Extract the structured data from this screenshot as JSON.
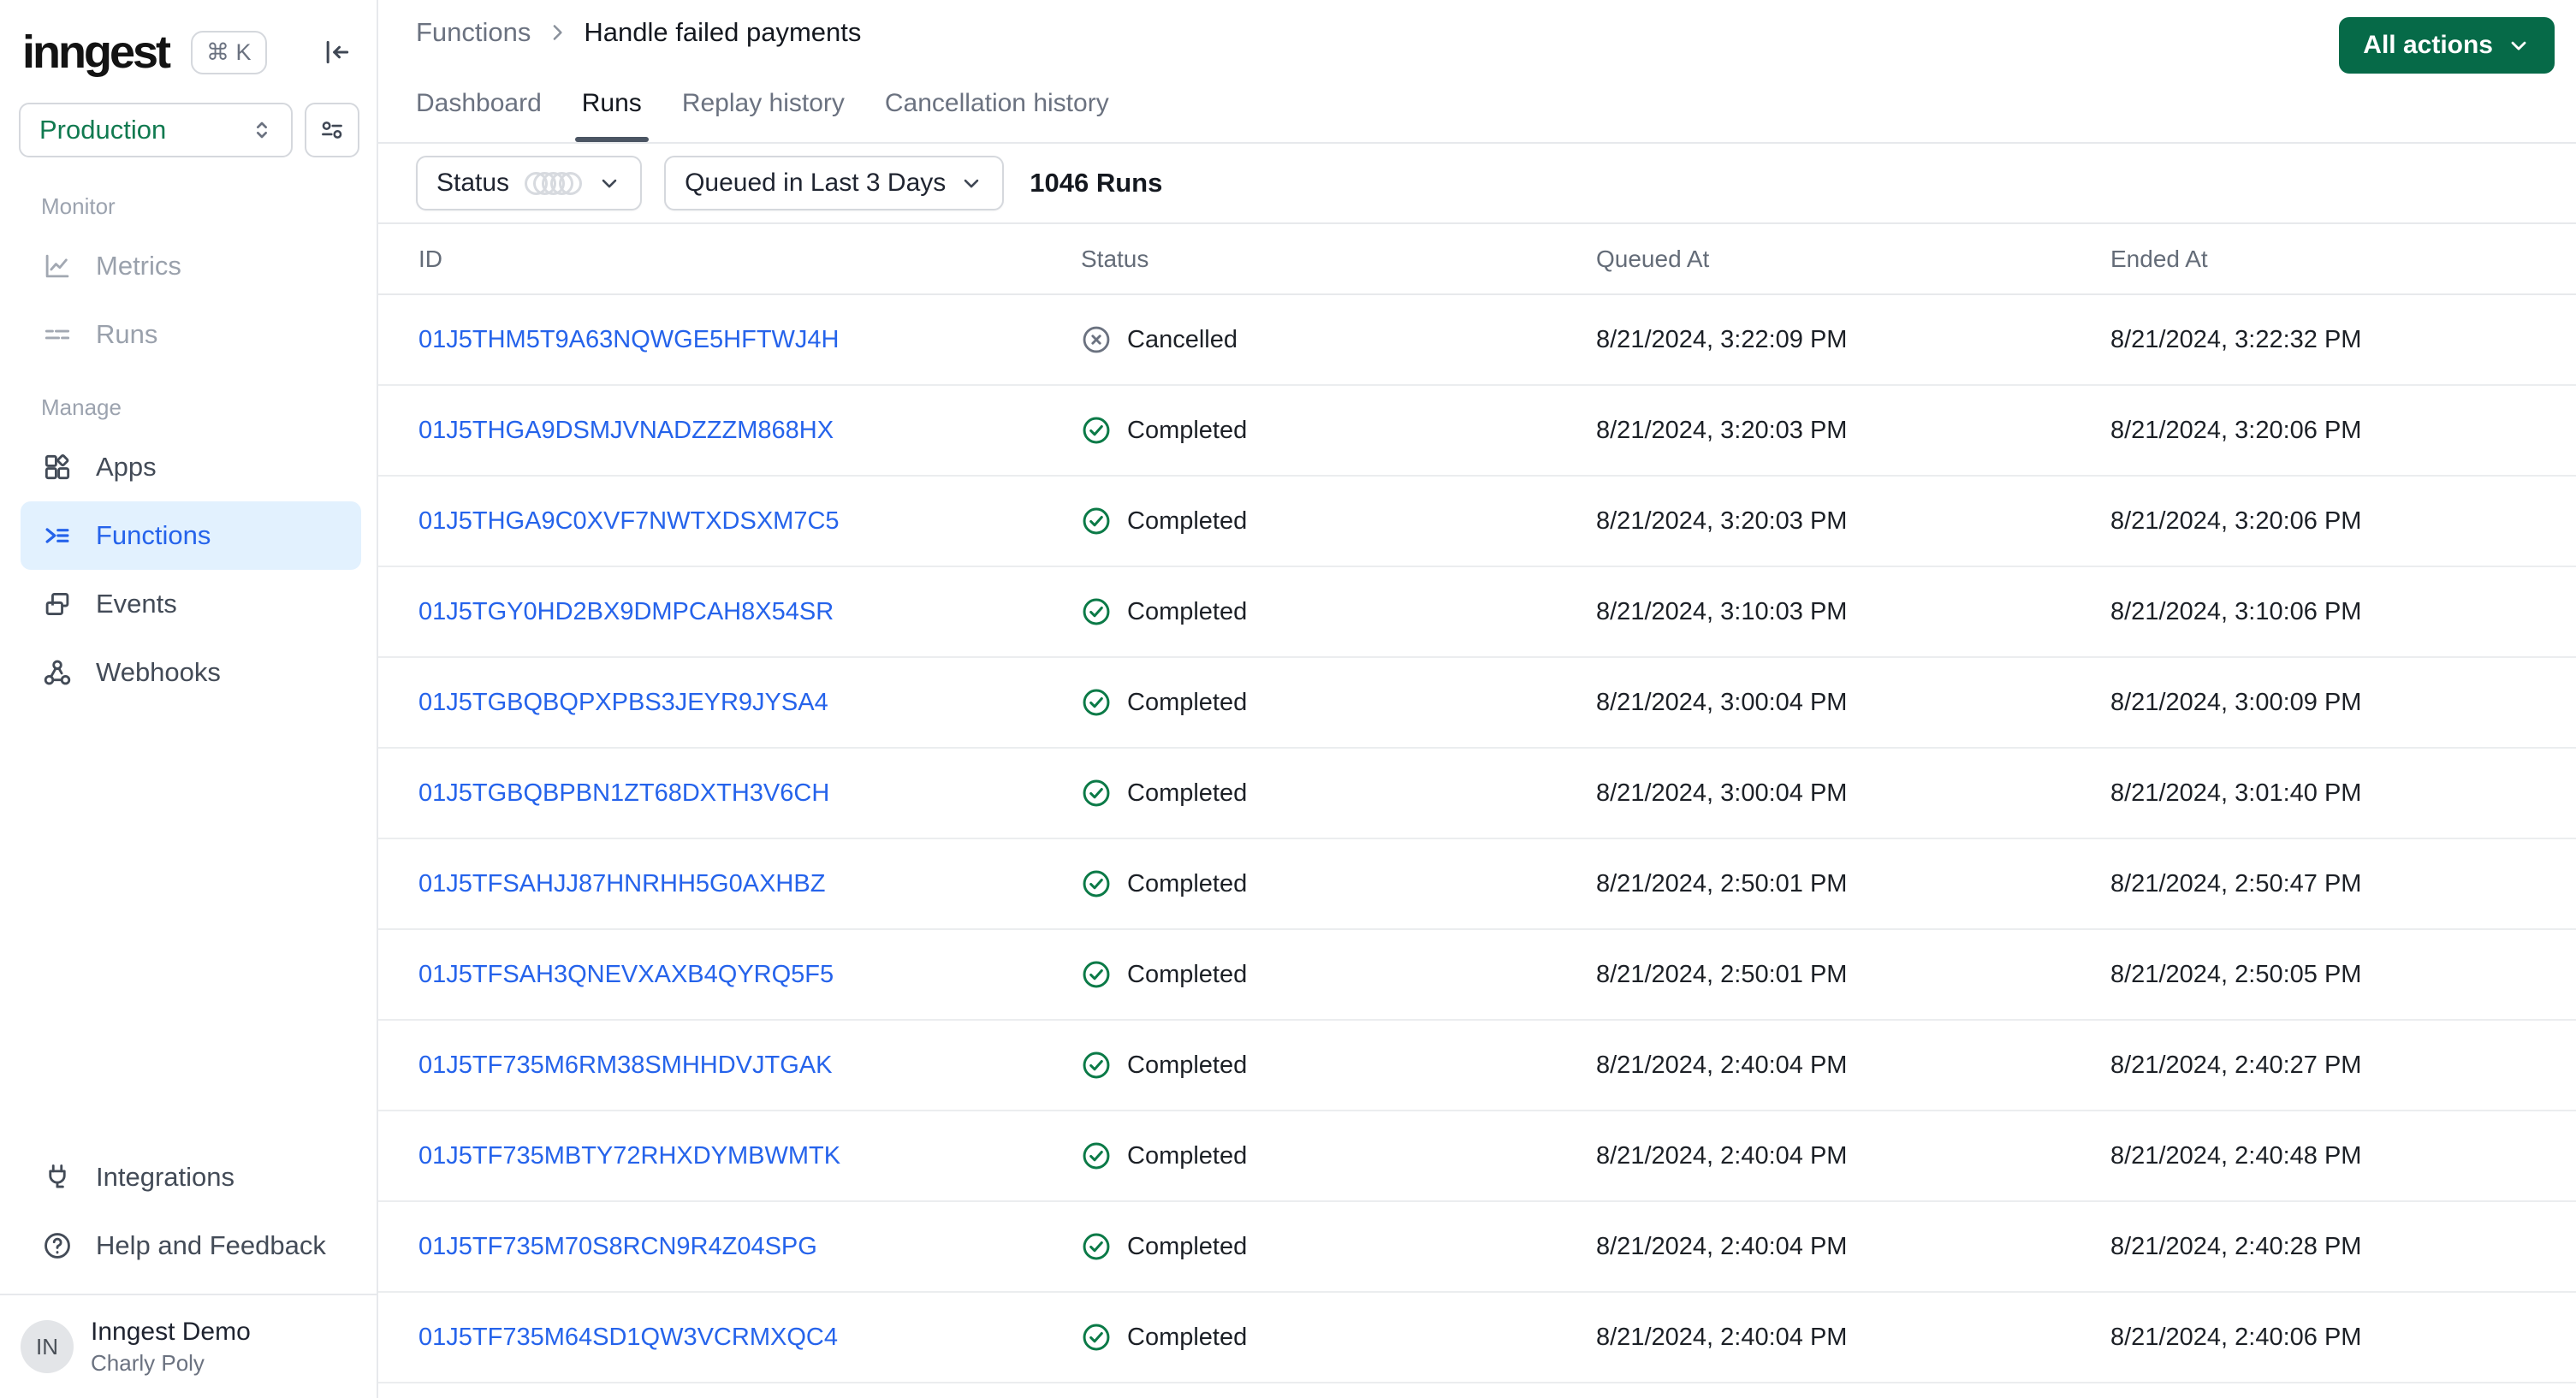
{
  "sidebar": {
    "logo_text": "inngest",
    "shortcut_badge": "⌘ K",
    "environment": {
      "selected": "Production"
    },
    "monitor": {
      "label": "Monitor",
      "items": [
        {
          "label": "Metrics",
          "icon": "chart-line-icon"
        },
        {
          "label": "Runs",
          "icon": "list-dashes-icon"
        }
      ]
    },
    "manage": {
      "label": "Manage",
      "items": [
        {
          "label": "Apps",
          "icon": "apps-grid-icon"
        },
        {
          "label": "Functions",
          "icon": "function-list-icon",
          "active": true
        },
        {
          "label": "Events",
          "icon": "windows-icon"
        },
        {
          "label": "Webhooks",
          "icon": "webhook-icon"
        }
      ]
    },
    "footer_items": [
      {
        "label": "Integrations",
        "icon": "plug-icon"
      },
      {
        "label": "Help and Feedback",
        "icon": "question-circle-icon"
      }
    ],
    "user": {
      "initials": "IN",
      "org": "Inngest Demo",
      "name": "Charly Poly"
    }
  },
  "header": {
    "breadcrumb": {
      "parent": "Functions",
      "current": "Handle failed payments"
    },
    "tabs": [
      {
        "label": "Dashboard",
        "active": false
      },
      {
        "label": "Runs",
        "active": true
      },
      {
        "label": "Replay history",
        "active": false
      },
      {
        "label": "Cancellation history",
        "active": false
      }
    ],
    "actions_button_label": "All actions"
  },
  "filters": {
    "status_label": "Status",
    "time_range_label": "Queued in Last 3 Days",
    "runs_count": "1046 Runs"
  },
  "table": {
    "headers": [
      "ID",
      "Status",
      "Queued At",
      "Ended At"
    ],
    "rows": [
      {
        "id": "01J5THM5T9A63NQWGE5HFTWJ4H",
        "status": "Cancelled",
        "queued_at": "8/21/2024, 3:22:09 PM",
        "ended_at": "8/21/2024, 3:22:32 PM"
      },
      {
        "id": "01J5THGA9DSMJVNADZZZM868HX",
        "status": "Completed",
        "queued_at": "8/21/2024, 3:20:03 PM",
        "ended_at": "8/21/2024, 3:20:06 PM"
      },
      {
        "id": "01J5THGA9C0XVF7NWTXDSXM7C5",
        "status": "Completed",
        "queued_at": "8/21/2024, 3:20:03 PM",
        "ended_at": "8/21/2024, 3:20:06 PM"
      },
      {
        "id": "01J5TGY0HD2BX9DMPCAH8X54SR",
        "status": "Completed",
        "queued_at": "8/21/2024, 3:10:03 PM",
        "ended_at": "8/21/2024, 3:10:06 PM"
      },
      {
        "id": "01J5TGBQBQPXPBS3JEYR9JYSA4",
        "status": "Completed",
        "queued_at": "8/21/2024, 3:00:04 PM",
        "ended_at": "8/21/2024, 3:00:09 PM"
      },
      {
        "id": "01J5TGBQBPBN1ZT68DXTH3V6CH",
        "status": "Completed",
        "queued_at": "8/21/2024, 3:00:04 PM",
        "ended_at": "8/21/2024, 3:01:40 PM"
      },
      {
        "id": "01J5TFSAHJJ87HNRHH5G0AXHBZ",
        "status": "Completed",
        "queued_at": "8/21/2024, 2:50:01 PM",
        "ended_at": "8/21/2024, 2:50:47 PM"
      },
      {
        "id": "01J5TFSAH3QNEVXAXB4QYRQ5F5",
        "status": "Completed",
        "queued_at": "8/21/2024, 2:50:01 PM",
        "ended_at": "8/21/2024, 2:50:05 PM"
      },
      {
        "id": "01J5TF735M6RM38SMHHDVJTGAK",
        "status": "Completed",
        "queued_at": "8/21/2024, 2:40:04 PM",
        "ended_at": "8/21/2024, 2:40:27 PM"
      },
      {
        "id": "01J5TF735MBTY72RHXDYMBWMTK",
        "status": "Completed",
        "queued_at": "8/21/2024, 2:40:04 PM",
        "ended_at": "8/21/2024, 2:40:48 PM"
      },
      {
        "id": "01J5TF735M70S8RCN9R4Z04SPG",
        "status": "Completed",
        "queued_at": "8/21/2024, 2:40:04 PM",
        "ended_at": "8/21/2024, 2:40:28 PM"
      },
      {
        "id": "01J5TF735M64SD1QW3VCRMXQC4",
        "status": "Completed",
        "queued_at": "8/21/2024, 2:40:04 PM",
        "ended_at": "8/21/2024, 2:40:06 PM"
      }
    ]
  },
  "colors": {
    "accent_green": "#066A48",
    "production_green": "#117A50",
    "link_blue": "#2563EB",
    "active_item_bg": "#E2F1FE",
    "status_completed_green": "#0B7A47",
    "status_cancelled_gray": "#6B7280"
  }
}
